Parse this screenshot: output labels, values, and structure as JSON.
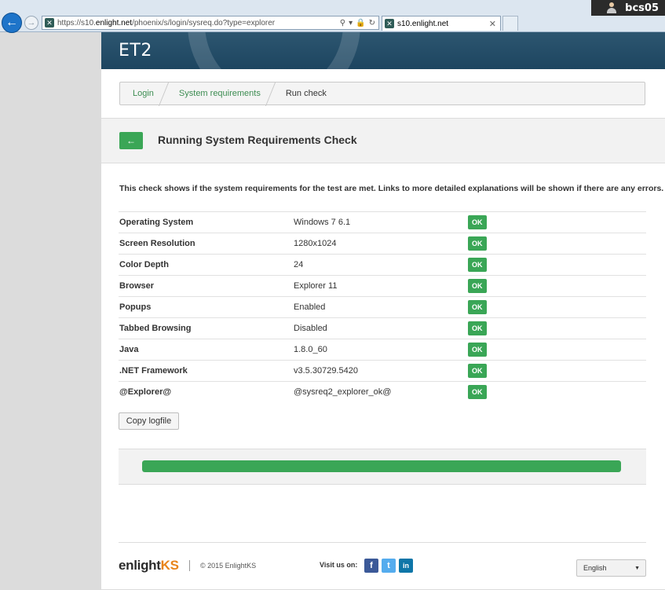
{
  "browser": {
    "url_prefix": "https://s10.",
    "url_domain": "enlight.net",
    "url_path": "/phoenix/s/login/sysreq.do?type=explorer",
    "tab_title": "s10.enlight.net",
    "user": "bcs05"
  },
  "header": {
    "logo": "ET2"
  },
  "breadcrumb": [
    {
      "label": "Login"
    },
    {
      "label": "System requirements"
    },
    {
      "label": "Run check"
    }
  ],
  "page": {
    "title": "Running System Requirements Check",
    "intro": "This check shows if the system requirements for the test are met. Links to more detailed explanations will be shown if there are any errors."
  },
  "requirements": [
    {
      "label": "Operating System",
      "value": "Windows 7 6.1",
      "status": "OK"
    },
    {
      "label": "Screen Resolution",
      "value": "1280x1024",
      "status": "OK"
    },
    {
      "label": "Color Depth",
      "value": "24",
      "status": "OK"
    },
    {
      "label": "Browser",
      "value": "Explorer 11",
      "status": "OK"
    },
    {
      "label": "Popups",
      "value": "Enabled",
      "status": "OK"
    },
    {
      "label": "Tabbed Browsing",
      "value": "Disabled",
      "status": "OK"
    },
    {
      "label": "Java",
      "value": "1.8.0_60",
      "status": "OK"
    },
    {
      "label": ".NET Framework",
      "value": "v3.5.30729.5420",
      "status": "OK"
    },
    {
      "label": "@Explorer@",
      "value": "@sysreq2_explorer_ok@",
      "status": "OK"
    }
  ],
  "actions": {
    "copy_logfile": "Copy logfile"
  },
  "progress": {
    "percent": 100
  },
  "footer": {
    "brand_main": "enlight",
    "brand_accent": "KS",
    "copyright": "© 2015 EnlightKS",
    "visit_label": "Visit us on:",
    "language": "English"
  },
  "colors": {
    "accent_green": "#3aa656",
    "banner": "#1d4560",
    "link_green": "#3d8d52",
    "brand_orange": "#e8841a"
  },
  "icons": {
    "back": "arrow-left-icon",
    "forward": "arrow-right-icon",
    "search": "search-icon",
    "lock": "lock-icon",
    "refresh": "refresh-icon",
    "facebook": "facebook-icon",
    "twitter": "twitter-icon",
    "linkedin": "linkedin-icon"
  }
}
